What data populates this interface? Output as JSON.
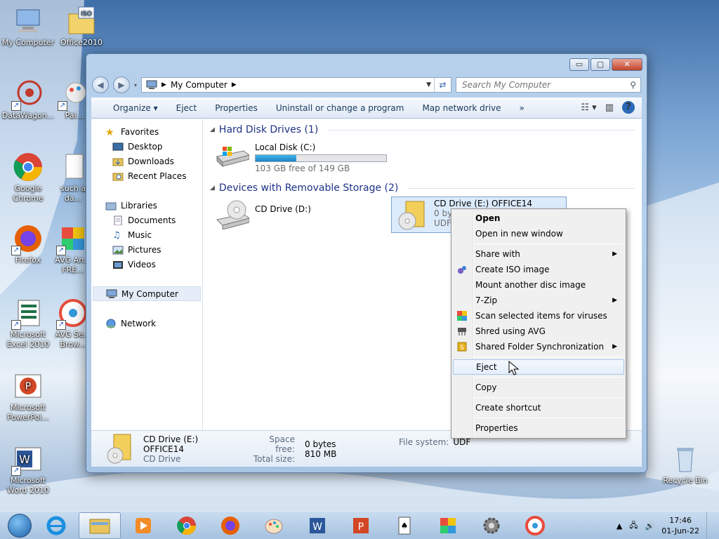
{
  "desktop": {
    "icons": [
      {
        "label": "My Computer"
      },
      {
        "label": "Office2010"
      },
      {
        "label": "DataWagon..."
      },
      {
        "label": "Pai..."
      },
      {
        "label": "Google Chrome"
      },
      {
        "label": "such a da..."
      },
      {
        "label": "Firefox"
      },
      {
        "label": "AVG An... FRE..."
      },
      {
        "label": "Microsoft Excel 2010"
      },
      {
        "label": "AVG Se... Brow..."
      },
      {
        "label": "Microsoft PowerPoi..."
      },
      {
        "label": "Microsoft Word 2010"
      },
      {
        "label": "Recycle Bin"
      }
    ],
    "office_badge": "ISO"
  },
  "window": {
    "controls": {
      "minimize": "▭",
      "maximize": "▢",
      "close": "✕"
    },
    "address": {
      "path": "My Computer"
    },
    "search": {
      "placeholder": "Search My Computer"
    },
    "toolbar": {
      "organize": "Organize ▾",
      "eject": "Eject",
      "properties": "Properties",
      "uninstall": "Uninstall or change a program",
      "map_drive": "Map network drive",
      "more": "»"
    },
    "nav": {
      "favorites": "Favorites",
      "desktop": "Desktop",
      "downloads": "Downloads",
      "recent": "Recent Places",
      "libraries": "Libraries",
      "documents": "Documents",
      "music": "Music",
      "pictures": "Pictures",
      "videos": "Videos",
      "my_computer": "My Computer",
      "network": "Network"
    },
    "groups": {
      "hdd": "Hard Disk Drives (1)",
      "removable": "Devices with Removable Storage (2)"
    },
    "drives": {
      "c": {
        "name": "Local Disk (C:)",
        "free": "103 GB free of 149 GB",
        "used_fraction": 0.31
      },
      "d": {
        "name": "CD Drive (D:)"
      },
      "e": {
        "name": "CD Drive (E:) OFFICE14",
        "sub1": "0 bytes free of 810 MB",
        "sub2": "UDF"
      }
    },
    "details": {
      "name": "CD Drive (E:) OFFICE14",
      "type": "CD Drive",
      "space_free_label": "Space free:",
      "space_free": "0 bytes",
      "total_size_label": "Total size:",
      "total_size": "810 MB",
      "fs_label": "File system:",
      "fs": "UDF"
    }
  },
  "context_menu": {
    "open": "Open",
    "open_new": "Open in new window",
    "share": "Share with",
    "create_iso": "Create ISO image",
    "mount": "Mount another disc image",
    "zip": "7-Zip",
    "scan": "Scan selected items for viruses",
    "shred": "Shred using AVG",
    "sync": "Shared Folder Synchronization",
    "eject": "Eject",
    "copy": "Copy",
    "shortcut": "Create shortcut",
    "properties": "Properties"
  },
  "taskbar": {
    "time": "17:46",
    "date": "01-Jun-22"
  }
}
